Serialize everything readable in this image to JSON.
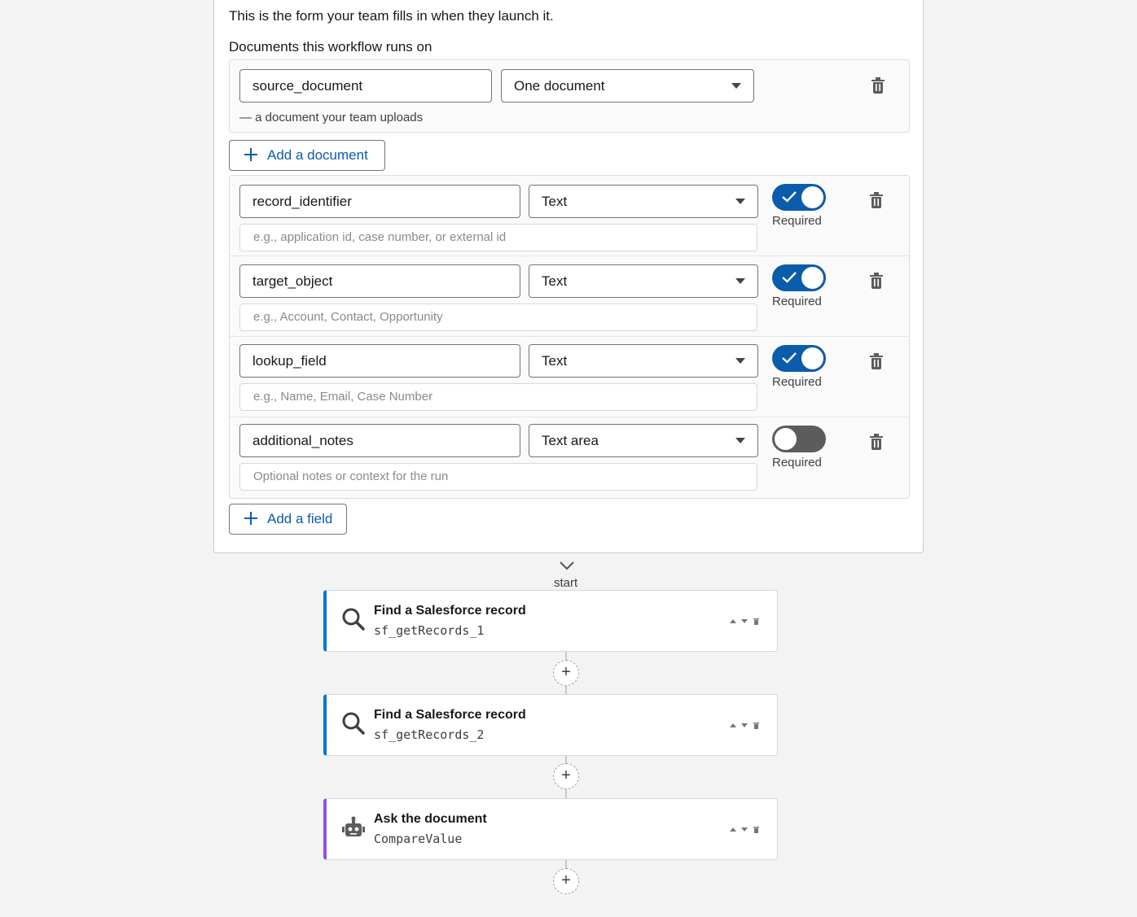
{
  "form": {
    "intro": "This is the form your team fills in when they launch it.",
    "documents_label": "Documents this workflow runs on",
    "document": {
      "name": "source_document",
      "type": "One document",
      "hint": "— a document your team uploads"
    },
    "add_document_label": "Add a document",
    "fields": [
      {
        "name": "record_identifier",
        "type": "Text",
        "placeholder": "e.g., application id, case number, or external id",
        "required": true,
        "required_label": "Required"
      },
      {
        "name": "target_object",
        "type": "Text",
        "placeholder": "e.g., Account, Contact, Opportunity",
        "required": true,
        "required_label": "Required"
      },
      {
        "name": "lookup_field",
        "type": "Text",
        "placeholder": "e.g., Name, Email, Case Number",
        "required": true,
        "required_label": "Required"
      },
      {
        "name": "additional_notes",
        "type": "Text area",
        "placeholder": "Optional notes or context for the run",
        "required": false,
        "required_label": "Required"
      }
    ],
    "add_field_label": "Add a field"
  },
  "flow": {
    "start_label": "start",
    "steps": [
      {
        "title": "Find a Salesforce record",
        "id": "sf_getRecords_1",
        "icon": "search-icon",
        "accent": "#0176d3"
      },
      {
        "title": "Find a Salesforce record",
        "id": "sf_getRecords_2",
        "icon": "search-icon",
        "accent": "#0176d3"
      },
      {
        "title": "Ask the document",
        "id": "CompareValue",
        "icon": "robot-icon",
        "accent": "#9050e9"
      }
    ],
    "add_step_symbol": "+"
  },
  "colors": {
    "accent": "#0b5cab",
    "toggle_on": "#0b5cab",
    "toggle_off": "#5c5c5c"
  }
}
